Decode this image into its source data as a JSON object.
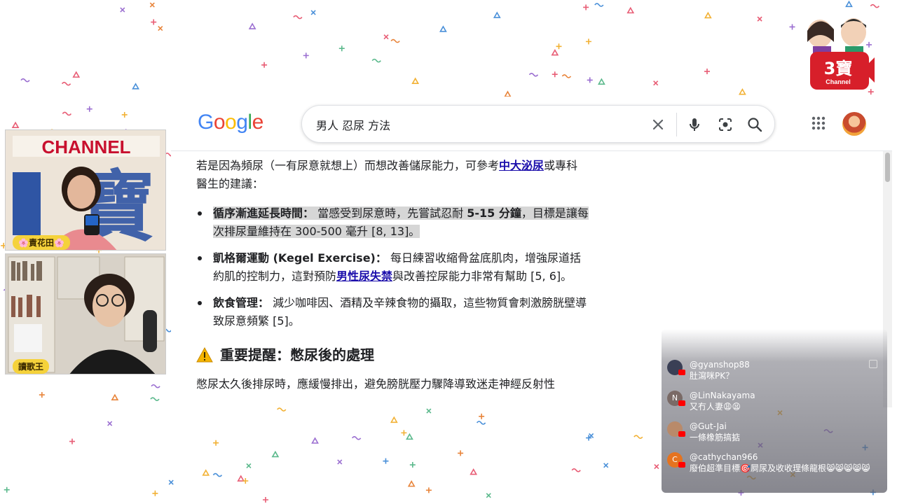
{
  "search": {
    "query": "男人 忍尿 方法"
  },
  "google_logo": [
    "G",
    "o",
    "o",
    "g",
    "l",
    "e"
  ],
  "result": {
    "intro_1": "若是因為頻尿（一有尿意就想上）而想改善儲尿能力，可參考",
    "intro_link": "中大泌尿",
    "intro_2": "或專科醫生的建議：",
    "bullets": [
      {
        "title": "循序漸進延長時間：",
        "text_1": "當感受到尿意時，先嘗試忍耐",
        "bold": "5-15 分鐘",
        "text_2": "，目標是讓每次排尿量維持在 300-500 毫升 [8, 13]。"
      },
      {
        "title": "凱格爾運動 (Kegel Exercise)：",
        "text_1": "每日練習收縮骨盆底肌肉，增強尿道括約肌的控制力，這對預防",
        "link": "男性尿失禁",
        "text_2": "與改善控尿能力非常有幫助 [5, 6]。"
      },
      {
        "title": "飲食管理：",
        "text_1": "減少咖啡因、酒精及辛辣食物的攝取，這些物質會刺激膀胱壁導致尿意頻繁 [5]。"
      }
    ],
    "warning_heading": "重要提醒：憋尿後的處理",
    "cut_line": "憋尿太久後排尿時，應緩慢排出，避免膀胱壓力驟降導致迷走神經反射性"
  },
  "cams": {
    "host1_name": "🌸責花田🌸",
    "host2_name": "讀歌王",
    "backdrop_text": "CHANNEL",
    "backdrop_char": "寶"
  },
  "logo": {
    "big": "3寶",
    "small": "Channel"
  },
  "chat": {
    "messages": [
      {
        "user": "@gyanshop88",
        "text": "肚瀉咪PK？",
        "avatar_color": "#3a3f55",
        "initial": ""
      },
      {
        "user": "@LinNakayama",
        "text": "又冇人妻😩😫",
        "avatar_color": "#7a6a66",
        "initial": "N"
      },
      {
        "user": "@Gut-Jai",
        "text": "一條橡筋搞掂",
        "avatar_color": "#b98a6a",
        "initial": ""
      },
      {
        "user": "@cathychan966",
        "text": "廢伯超準目標🎯屙尿及收收理條龍根😸😸😸😸😸",
        "avatar_color": "#e5731f",
        "initial": "C"
      }
    ]
  },
  "colors": {
    "google_blue": "#4285F4",
    "google_red": "#EA4335",
    "google_yellow": "#FBBC05",
    "google_green": "#34A853",
    "link": "#1a0dab"
  }
}
